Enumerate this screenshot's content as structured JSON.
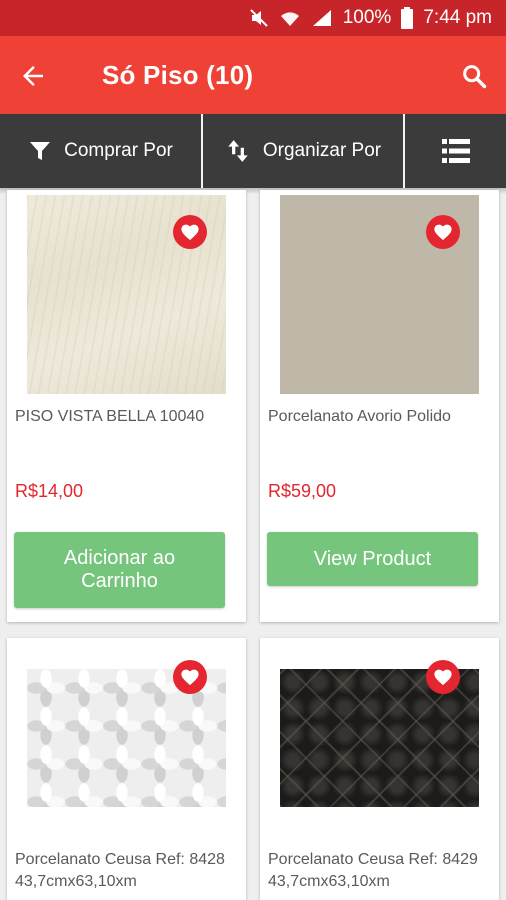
{
  "status_bar": {
    "battery": "100%",
    "time": "7:44 pm"
  },
  "app_bar": {
    "title": "Só Piso (10)"
  },
  "toolbar": {
    "buy_by_label": "Comprar Por",
    "sort_by_label": "Organizar Por"
  },
  "colors": {
    "app_bar": "#ef4136",
    "status_bar": "#c8252a",
    "toolbar": "#3b3b3b",
    "button": "#76c57d",
    "price": "#e3262f"
  },
  "products": [
    {
      "name": "PISO VISTA BELLA 10040",
      "price": "R$14,00",
      "button": "Adicionar ao Carrinho",
      "favorite_icon": "heart-icon"
    },
    {
      "name": "Porcelanato Avorio Polido",
      "price": "R$59,00",
      "button": "View Product",
      "favorite_icon": "heart-icon"
    },
    {
      "name": "Porcelanato Ceusa Ref: 8428 43,7cmx63,10xm",
      "favorite_icon": "heart-icon"
    },
    {
      "name": "Porcelanato Ceusa Ref: 8429 43,7cmx63,10xm",
      "favorite_icon": "heart-icon"
    }
  ]
}
